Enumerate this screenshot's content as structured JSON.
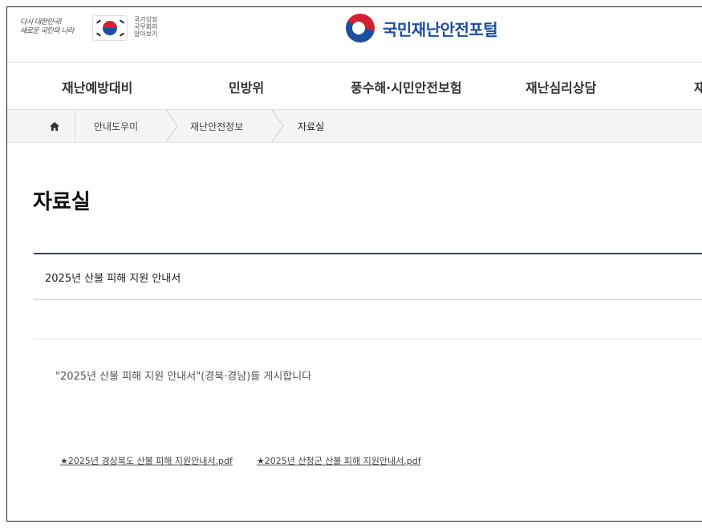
{
  "header": {
    "slogan_line1": "다시 대한민국!",
    "slogan_line2": "새로운 국민의 나라",
    "mini_title_line1": "국가상징",
    "mini_title_line2": "국무회의",
    "mini_title_line3": "알아보기",
    "site_name": "국민재난안전포털",
    "brand_blue": "#1c4fa0",
    "brand_red": "#d21f34"
  },
  "nav": {
    "items": [
      "재난예방대비",
      "민방위",
      "풍수해·시민안전보험",
      "재난심리상담",
      "재"
    ]
  },
  "breadcrumb": {
    "home_icon": "home-icon",
    "items": [
      "안내도우미",
      "재난안전정보",
      "자료실"
    ]
  },
  "page": {
    "title": "자료실"
  },
  "post": {
    "title": "2025년 산불 피해 지원 안내서",
    "body": "\"2025년 산불 피해 지원 안내서\"(경북·경남)를 게시합니다",
    "attachments": [
      "★2025년 경상북도 산불 피해 지원안내서.pdf",
      "★2025년 산청군 산불 피해 지원안내서.pdf"
    ],
    "accent_color": "#23408e"
  }
}
